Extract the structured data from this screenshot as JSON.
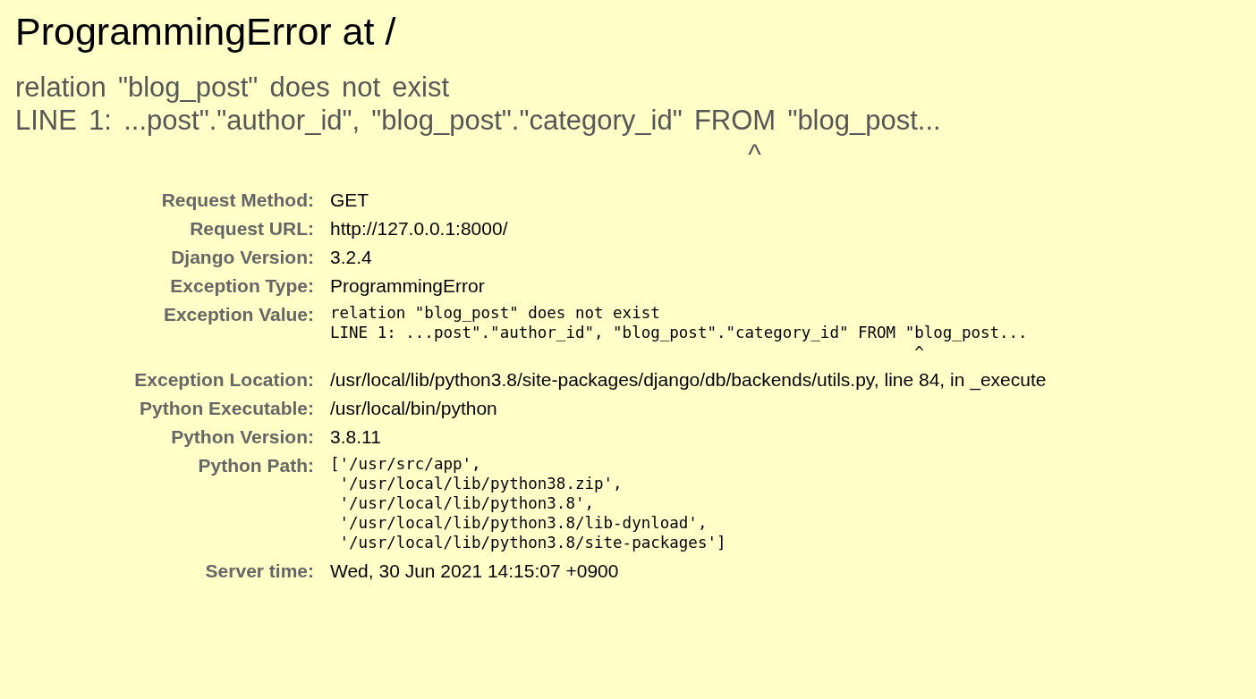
{
  "title": "ProgrammingError at /",
  "summary": "relation \"blog_post\" does not exist\nLINE 1: ...post\".\"author_id\", \"blog_post\".\"category_id\" FROM \"blog_post...\n                                                              ^",
  "meta": [
    {
      "label": "Request Method:",
      "kind": "text",
      "value": "GET"
    },
    {
      "label": "Request URL:",
      "kind": "text",
      "value": "http://127.0.0.1:8000/"
    },
    {
      "label": "Django Version:",
      "kind": "text",
      "value": "3.2.4"
    },
    {
      "label": "Exception Type:",
      "kind": "text",
      "value": "ProgrammingError"
    },
    {
      "label": "Exception Value:",
      "kind": "pre",
      "value": "relation \"blog_post\" does not exist\nLINE 1: ...post\".\"author_id\", \"blog_post\".\"category_id\" FROM \"blog_post...\n                                                              ^"
    },
    {
      "label": "Exception Location:",
      "kind": "text",
      "value": "/usr/local/lib/python3.8/site-packages/django/db/backends/utils.py, line 84, in _execute"
    },
    {
      "label": "Python Executable:",
      "kind": "text",
      "value": "/usr/local/bin/python"
    },
    {
      "label": "Python Version:",
      "kind": "text",
      "value": "3.8.11"
    },
    {
      "label": "Python Path:",
      "kind": "pre",
      "value": "['/usr/src/app',\n '/usr/local/lib/python38.zip',\n '/usr/local/lib/python3.8',\n '/usr/local/lib/python3.8/lib-dynload',\n '/usr/local/lib/python3.8/site-packages']"
    },
    {
      "label": "Server time:",
      "kind": "text",
      "value": "Wed, 30 Jun 2021 14:15:07 +0900"
    }
  ]
}
